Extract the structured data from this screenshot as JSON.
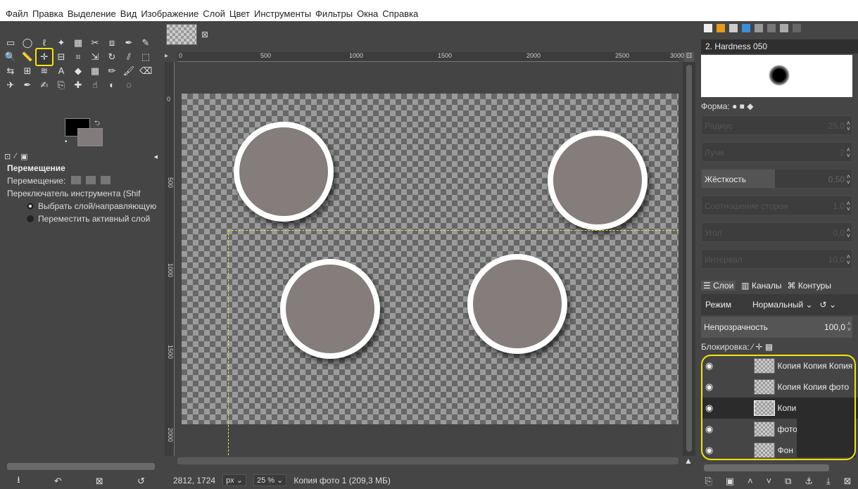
{
  "menubar": {
    "items": [
      "Файл",
      "Правка",
      "Выделение",
      "Вид",
      "Изображение",
      "Слой",
      "Цвет",
      "Инструменты",
      "Фильтры",
      "Окна",
      "Справка"
    ]
  },
  "toolbox": {
    "tools": [
      "rectangle-select-icon",
      "ellipse-select-icon",
      "lasso-icon",
      "fuzzy-select-icon",
      "by-color-select-icon",
      "scissors-icon",
      "foreground-select-icon",
      "paths-icon",
      "color-picker-icon",
      "zoom-icon",
      "measure-icon",
      "move-icon",
      "align-icon",
      "crop-icon",
      "unified-transform-icon",
      "rotate-icon",
      "shear-icon",
      "perspective-icon",
      "flip-icon",
      "cage-icon",
      "warp-icon",
      "text-icon",
      "bucket-fill-icon",
      "gradient-icon",
      "pencil-icon",
      "paintbrush-icon",
      "eraser-icon",
      "airbrush-icon",
      "ink-icon",
      "mypaint-brush-icon",
      "clone-icon",
      "heal-icon",
      "smudge-icon",
      "dodge-icon",
      "blur-icon"
    ],
    "active_tool": "move-icon"
  },
  "tool_options": {
    "title": "Перемещение",
    "move_label": "Перемещение:",
    "switch_label": "Переключатель инструмента (Shif",
    "option1": "Выбрать слой/направляющую",
    "option2": "Переместить активный слой"
  },
  "canvas": {
    "ruler_h": [
      "0",
      "500",
      "1000",
      "1500",
      "2000",
      "2500",
      "3000"
    ],
    "ruler_v": [
      "0",
      "500",
      "1000",
      "1500",
      "2000"
    ]
  },
  "statusbar": {
    "coords": "2812, 1724",
    "unit": "px",
    "zoom": "25 %",
    "title": "Копия фото 1 (209,3 МБ)"
  },
  "brushes": {
    "name": "2. Hardness 050",
    "shape_label": "Форма:",
    "sliders": [
      {
        "label": "Радиус",
        "value": "25,0"
      },
      {
        "label": "Лучи",
        "value": "2"
      },
      {
        "label": "Жёсткость",
        "value": "0,50"
      },
      {
        "label": "Соотношение сторон",
        "value": "1,0"
      },
      {
        "label": "Угол",
        "value": "0,0"
      },
      {
        "label": "Интервал",
        "value": "10,0"
      }
    ]
  },
  "layers_panel": {
    "tabs": [
      "Слои",
      "Каналы",
      "Контуры"
    ],
    "mode_label": "Режим",
    "mode_value": "Нормальный",
    "opacity_label": "Непрозрачность",
    "opacity_value": "100,0",
    "lock_label": "Блокировка:",
    "layers": [
      {
        "name": "Копия Копия Копия",
        "selected": false
      },
      {
        "name": "Копия Копия фото",
        "selected": false
      },
      {
        "name": "Копи",
        "selected": true
      },
      {
        "name": "фото",
        "selected": false
      },
      {
        "name": "Фон",
        "selected": false
      }
    ]
  },
  "colors": {
    "foreground": "#000000",
    "background": "#837b7b",
    "highlight": "#f4e40a",
    "circle_fill": "#857c7c"
  }
}
